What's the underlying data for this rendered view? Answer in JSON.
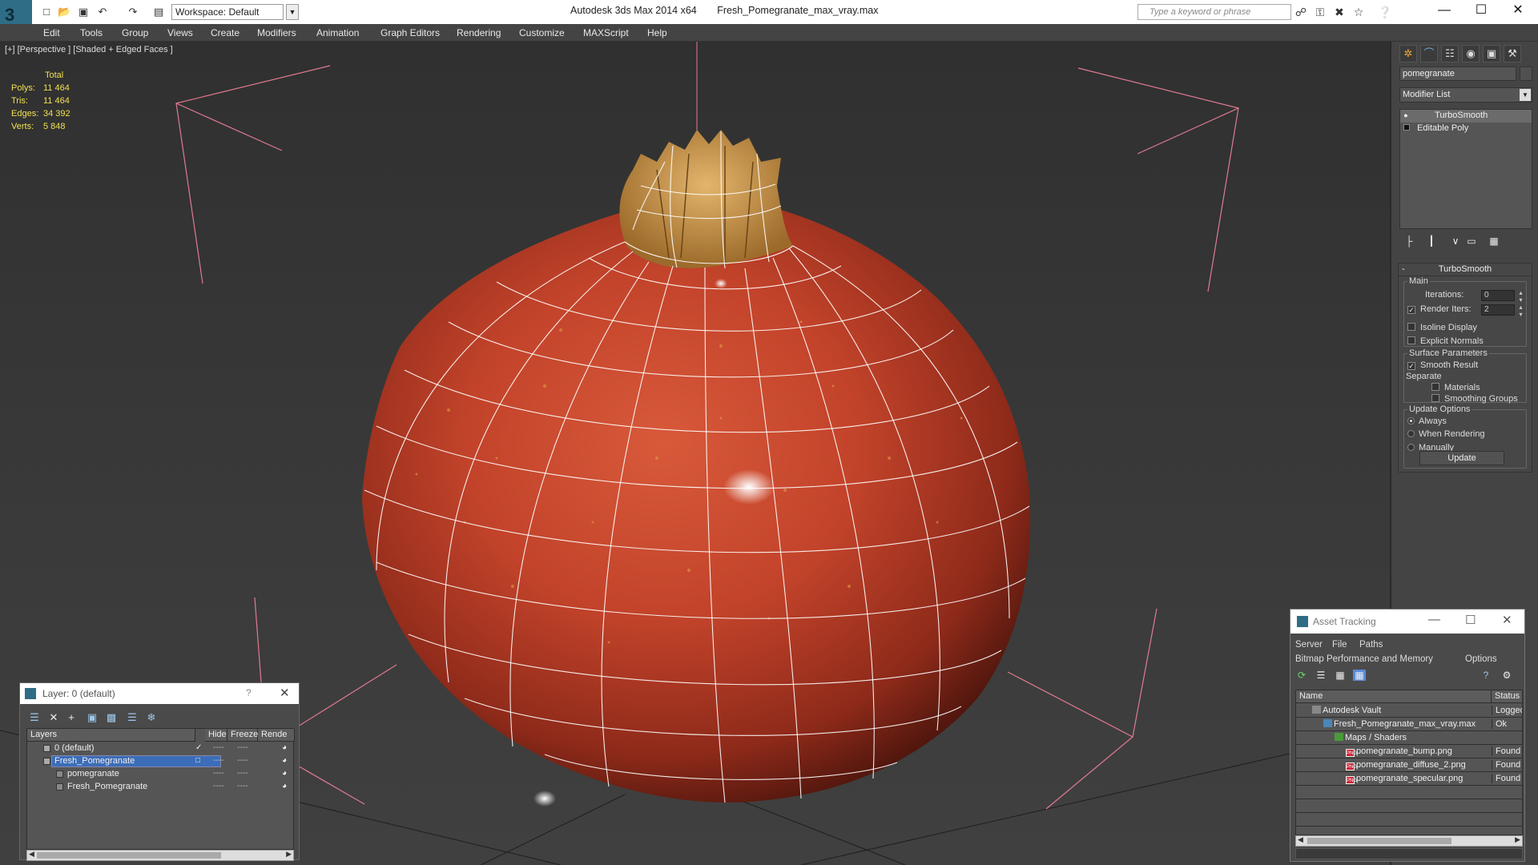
{
  "titlebar": {
    "workspace": "Workspace: Default",
    "app_title": "Autodesk 3ds Max  2014 x64",
    "file_name": "Fresh_Pomegranate_max_vray.max",
    "search_placeholder": "Type a keyword or phrase"
  },
  "menu": [
    "Edit",
    "Tools",
    "Group",
    "Views",
    "Create",
    "Modifiers",
    "Animation",
    "Graph Editors",
    "Rendering",
    "Customize",
    "MAXScript",
    "Help"
  ],
  "viewport": {
    "label": "[+] [Perspective ] [Shaded + Edged Faces ]",
    "stats_header": "Total",
    "stats": [
      {
        "label": "Polys:",
        "value": "11 464"
      },
      {
        "label": "Tris:",
        "value": "11 464"
      },
      {
        "label": "Edges:",
        "value": "34 392"
      },
      {
        "label": "Verts:",
        "value": "5 848"
      }
    ]
  },
  "command_panel": {
    "object_name": "pomegranate",
    "modifier_list": "Modifier List",
    "stack": [
      "TurboSmooth",
      "Editable Poly"
    ],
    "rollout_title": "TurboSmooth",
    "main_group": "Main",
    "iterations_label": "Iterations:",
    "iterations_value": "0",
    "render_iters_label": "Render Iters:",
    "render_iters_value": "2",
    "render_iters_checked": true,
    "isoline_label": "Isoline Display",
    "isoline_checked": false,
    "explicit_normals_label": "Explicit Normals",
    "explicit_normals_checked": false,
    "surface_group": "Surface Parameters",
    "smooth_result_label": "Smooth Result",
    "smooth_result_checked": true,
    "separate_label": "Separate",
    "materials_label": "Materials",
    "smoothing_groups_label": "Smoothing Groups",
    "update_group": "Update Options",
    "update_options": [
      "Always",
      "When Rendering",
      "Manually"
    ],
    "update_selected": "Always",
    "update_button": "Update"
  },
  "layer_window": {
    "title": "Layer: 0 (default)",
    "question": "?",
    "columns": [
      "Layers",
      "Hide",
      "Freeze",
      "Rende"
    ],
    "rows": [
      {
        "name": "0 (default)",
        "indent": 1,
        "selected": false
      },
      {
        "name": "Fresh_Pomegranate",
        "indent": 1,
        "selected": true
      },
      {
        "name": "pomegranate",
        "indent": 2,
        "selected": false
      },
      {
        "name": "Fresh_Pomegranate",
        "indent": 2,
        "selected": false
      }
    ],
    "dash": "----"
  },
  "asset_window": {
    "title": "Asset Tracking",
    "menu_row1": [
      "Server",
      "File",
      "Paths"
    ],
    "menu_row2": [
      "Bitmap Performance and Memory",
      "Options"
    ],
    "columns": [
      "Name",
      "Status"
    ],
    "rows": [
      {
        "name": "Autodesk Vault",
        "status": "Logged",
        "icon": "vault",
        "indent": 1
      },
      {
        "name": "Fresh_Pomegranate_max_vray.max",
        "status": "Ok",
        "icon": "max",
        "indent": 2
      },
      {
        "name": "Maps / Shaders",
        "status": "",
        "icon": "map",
        "indent": 3
      },
      {
        "name": "pomegranate_bump.png",
        "status": "Found",
        "icon": "png",
        "indent": 4
      },
      {
        "name": "pomegranate_diffuse_2.png",
        "status": "Found",
        "icon": "png",
        "indent": 4
      },
      {
        "name": "pomegranate_specular.png",
        "status": "Found",
        "icon": "png",
        "indent": 4
      }
    ],
    "png_tag": "PNG"
  },
  "colors": {
    "stats_text": "#f0e050",
    "selection_blue": "#3b6db8",
    "bounding_box": "#e07a90"
  }
}
